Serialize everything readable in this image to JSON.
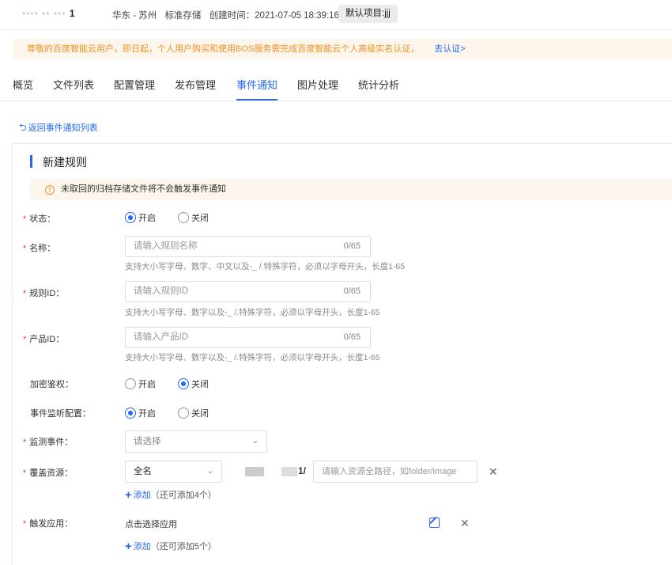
{
  "header": {
    "bucket_name_blur": "•••• •• •••",
    "bucket_name_tail": "1",
    "region": "华东 - 苏州",
    "storage_class": "标准存储",
    "created_label": "创建时间：2021-07-05 18:39:16",
    "project_tag": "默认项目:jjj"
  },
  "notice": {
    "text": "尊敬的百度智能云用户，即日起，个人用户购买和使用BOS服务需完成百度智能云个人高级实名认证，",
    "link": "去认证>"
  },
  "tabs": [
    {
      "label": "概览"
    },
    {
      "label": "文件列表"
    },
    {
      "label": "配置管理"
    },
    {
      "label": "发布管理"
    },
    {
      "label": "事件通知",
      "active": true
    },
    {
      "label": "图片处理"
    },
    {
      "label": "统计分析"
    }
  ],
  "back_link": "返回事件通知列表",
  "section_title": "新建规则",
  "warning": "未取回的归档存储文件将不会触发事件通知",
  "form": {
    "status": {
      "label": "状态：",
      "on": "开启",
      "off": "关闭",
      "selected": "on"
    },
    "name": {
      "label": "名称：",
      "placeholder": "请输入规则名称",
      "count": "0/65",
      "hint": "支持大小写字母、数字、中文以及-_ /.特殊字符，必须以字母开头，长度1-65"
    },
    "rule_id": {
      "label": "规则ID：",
      "placeholder": "请输入规则ID",
      "count": "0/65",
      "hint": "支持大小写字母、数字以及-_ /.特殊字符，必须以字母开头，长度1-65"
    },
    "product_id": {
      "label": "产品ID：",
      "placeholder": "请输入产品ID",
      "count": "0/65",
      "hint": "支持大小写字母、数字以及-_ /.特殊字符，必须以字母开头，长度1-65"
    },
    "encrypt_auth": {
      "label": "加密鉴权：",
      "on": "开启",
      "off": "关闭",
      "selected": "off"
    },
    "event_listen": {
      "label": "事件监听配置：",
      "on": "开启",
      "off": "关闭",
      "selected": "on"
    },
    "monitor_event": {
      "label": "监测事件：",
      "placeholder": "请选择"
    },
    "resource": {
      "label": "覆盖资源：",
      "mode": "全名",
      "prefix_tail": "1/",
      "placeholder": "请输入资源全路径，如folder/image",
      "add_label": "添加",
      "add_remaining": "（还可添加4个）"
    },
    "trigger_app": {
      "label": "触发应用：",
      "select_text": "点击选择应用",
      "add_label": "添加",
      "add_remaining": "（还可添加5个）"
    }
  },
  "colors": {
    "primary": "#2468f2",
    "warning": "#f39121",
    "required": "#e8393b"
  }
}
